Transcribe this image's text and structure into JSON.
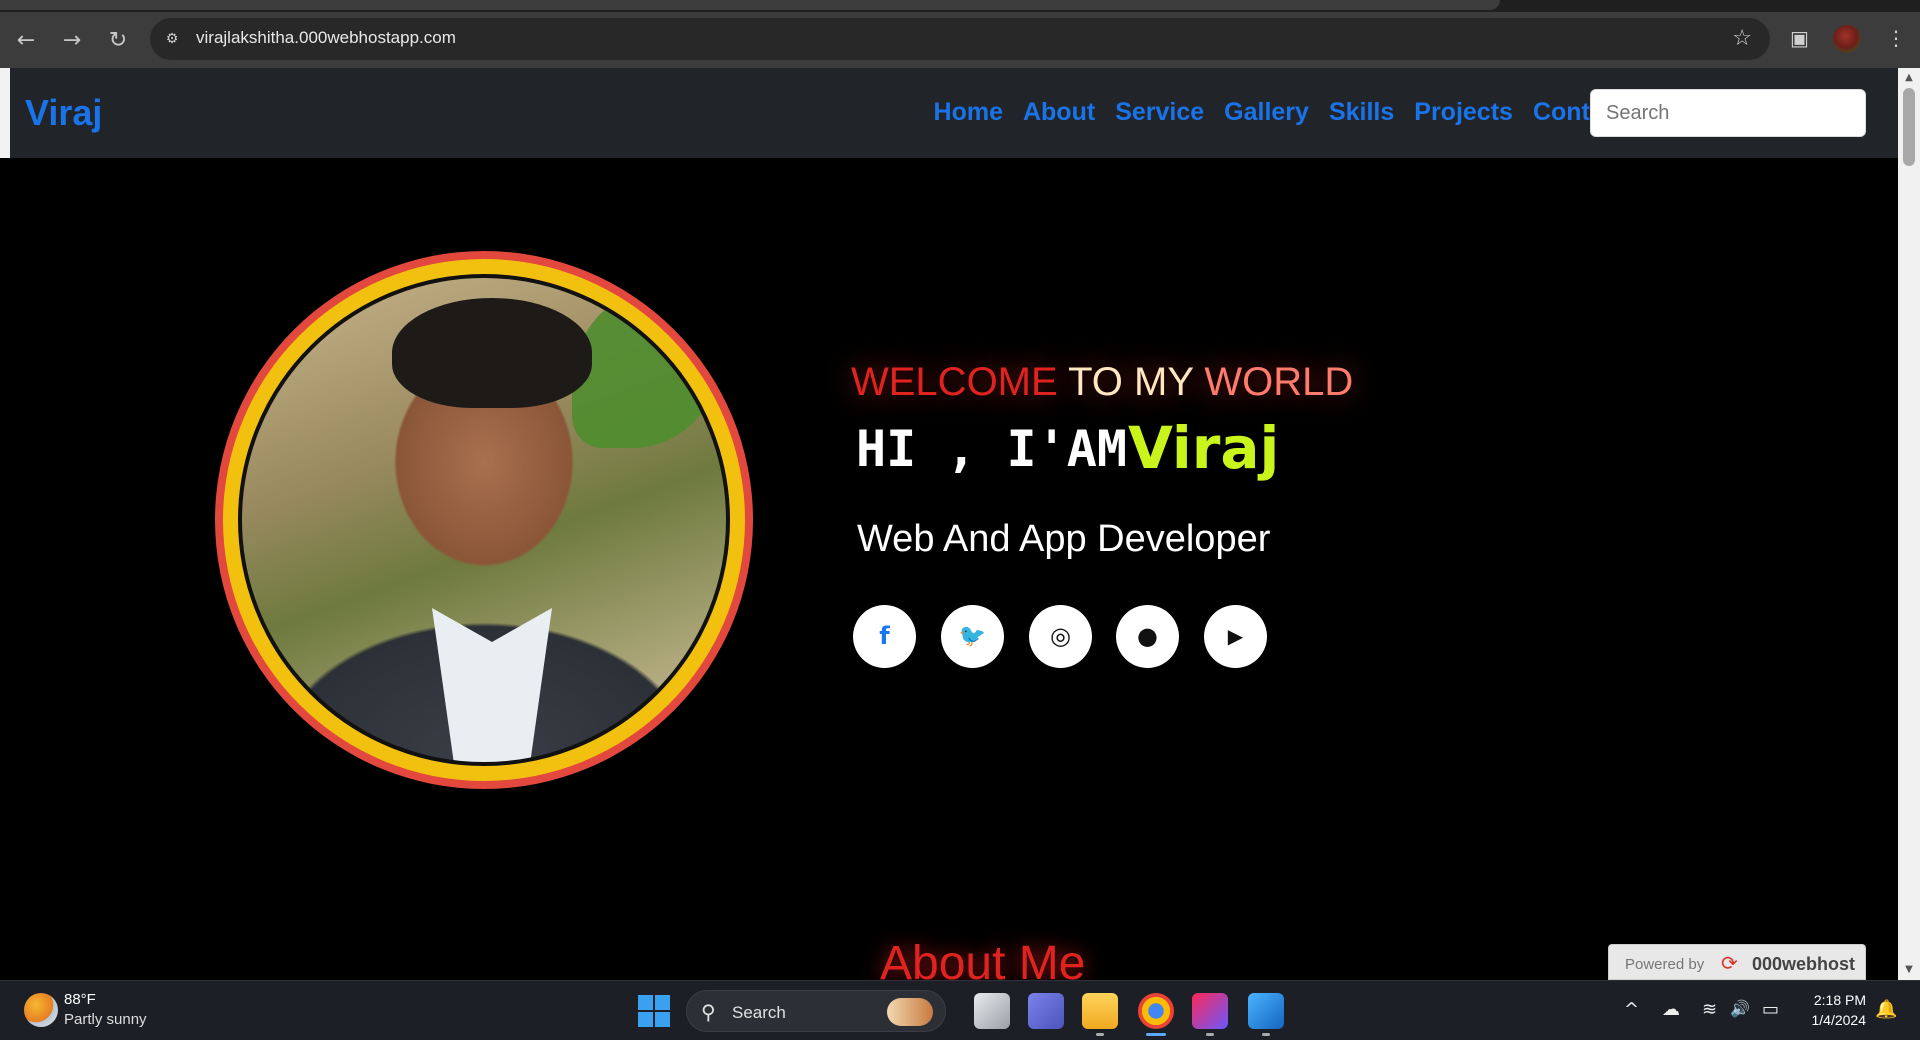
{
  "browser": {
    "url": "virajlakshitha.000webhostapp.com",
    "back_icon": "←",
    "forward_icon": "→",
    "reload_icon": "↻",
    "site_info_icon": "⚙",
    "star_icon": "☆",
    "sidepanel_icon": "▣",
    "menu_icon": "⋮"
  },
  "site": {
    "brand": "Viraj",
    "nav": [
      "Home",
      "About",
      "Service",
      "Gallery",
      "Skills",
      "Projects",
      "Contact"
    ],
    "search_placeholder": "Search",
    "accent_color": "#1a73e8"
  },
  "hero": {
    "welcome_1": "WELCOME",
    "welcome_2": "TO MY",
    "welcome_3": "WORLD",
    "greeting": "HI , I'AM",
    "name": "Viraj",
    "role": "Web And App Developer",
    "name_color": "#c9f51d",
    "social": [
      {
        "name": "facebook",
        "glyph": "f",
        "color": "#1877f2"
      },
      {
        "name": "twitter",
        "glyph": "🐦",
        "color": "#111111"
      },
      {
        "name": "instagram",
        "glyph": "◎",
        "color": "#111111"
      },
      {
        "name": "github",
        "glyph": "●",
        "color": "#111111"
      },
      {
        "name": "youtube",
        "glyph": "▶",
        "color": "#111111"
      }
    ]
  },
  "section_title": "About Me",
  "powered_badge": {
    "label": "Powered by",
    "brand": "000webhost",
    "logo_glyph": "⟳"
  },
  "taskbar": {
    "temperature": "88°F",
    "weather": "Partly sunny",
    "search_label": "Search",
    "search_icon": "⚲",
    "time": "2:18 PM",
    "date": "1/4/2024",
    "tray_chevron": "^",
    "tray_cloud": "☁",
    "tray_wifi": "≋",
    "tray_volume": "🔊",
    "tray_battery": "▭",
    "bell_icon": "🔔"
  }
}
